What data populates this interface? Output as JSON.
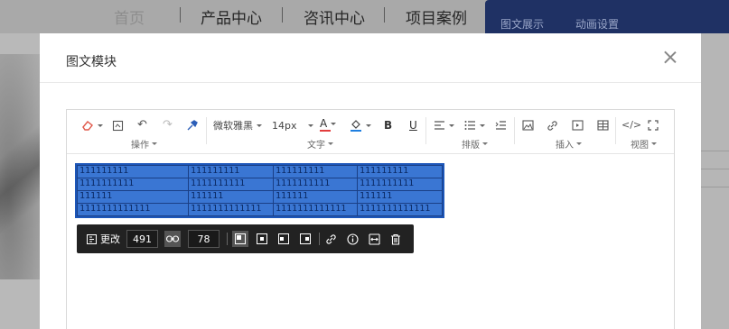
{
  "background_nav": {
    "items": [
      "首页",
      "产品中心",
      "咨讯中心",
      "项目案例"
    ],
    "tabs": [
      "图文展示",
      "动画设置"
    ]
  },
  "modal": {
    "title": "图文模块"
  },
  "toolbar": {
    "font_family": "微软雅黑",
    "font_size": "14px",
    "text_color_letter": "A",
    "bold_letter": "B",
    "underline_letter": "U",
    "groups": {
      "operation": "操作",
      "text": "文字",
      "layout": "排版",
      "insert": "插入",
      "view": "视图"
    }
  },
  "table": {
    "rows": [
      [
        "111111111",
        "111111111",
        "111111111",
        "111111111"
      ],
      [
        "1111111111",
        "1111111111",
        "1111111111",
        "1111111111"
      ],
      [
        "111111",
        "111111",
        "111111",
        "111111"
      ],
      [
        "1111111111111",
        "1111111111111",
        "1111111111111",
        "1111111111111"
      ]
    ]
  },
  "resize_toolbar": {
    "change_label": "更改",
    "width": "491",
    "height": "78"
  },
  "colors": {
    "accent": "#1f3164",
    "table_fill": "#3a76d3",
    "text_color_bar": "#e23d3d",
    "fill_color_bar": "#1f7fe0"
  }
}
